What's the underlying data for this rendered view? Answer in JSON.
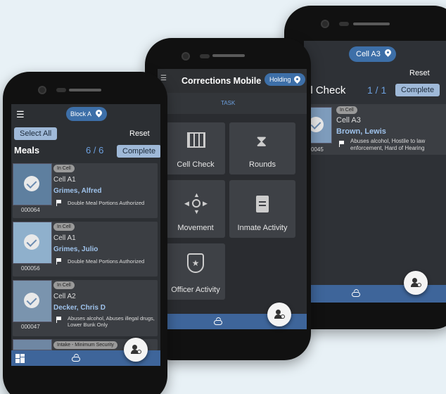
{
  "phone_right": {
    "location_pill": "Cell A3",
    "reset_label": "Reset",
    "title": "ll Check",
    "count": "1 / 1",
    "complete_label": "Complete",
    "card": {
      "status": "In Cell",
      "cell": "Cell A3",
      "name": "Brown, Lewis",
      "id": "0045",
      "alerts": "Abuses alcohol, Hostile to law enforcement, Hard of Hearing"
    }
  },
  "phone_middle": {
    "app_title": "Corrections Mobile",
    "location_pill": "Holding",
    "tab": "TASK",
    "tiles": [
      "Cell Check",
      "Rounds",
      "Movement",
      "Inmate Activity",
      "Officer Activity"
    ]
  },
  "phone_left": {
    "location_pill": "Block A",
    "select_all_label": "Select All",
    "reset_label": "Reset",
    "title": "Meals",
    "count": "6 / 6",
    "complete_label": "Complete",
    "cards": [
      {
        "status": "In Cell",
        "cell": "Cell A1",
        "name": "Grimes, Alfred",
        "id": "000064",
        "alerts": "Double Meal Portions Authorized"
      },
      {
        "status": "In Cell",
        "cell": "Cell A1",
        "name": "Grimes, Julio",
        "id": "000056",
        "alerts": "Double Meal Portions Authorized"
      },
      {
        "status": "In Cell",
        "cell": "Cell A2",
        "name": "Decker, Chris D",
        "id": "000047",
        "alerts": "Abuses alcohol, Abuses illegal drugs, Lower Bunk Only"
      }
    ],
    "partial_badge": "Intake - Minimum Security"
  },
  "colors": {
    "accent": "#3d6fa8",
    "button": "#9fb9d8",
    "screen_bg": "#2c2f33",
    "card_bg": "#3b3e43"
  }
}
